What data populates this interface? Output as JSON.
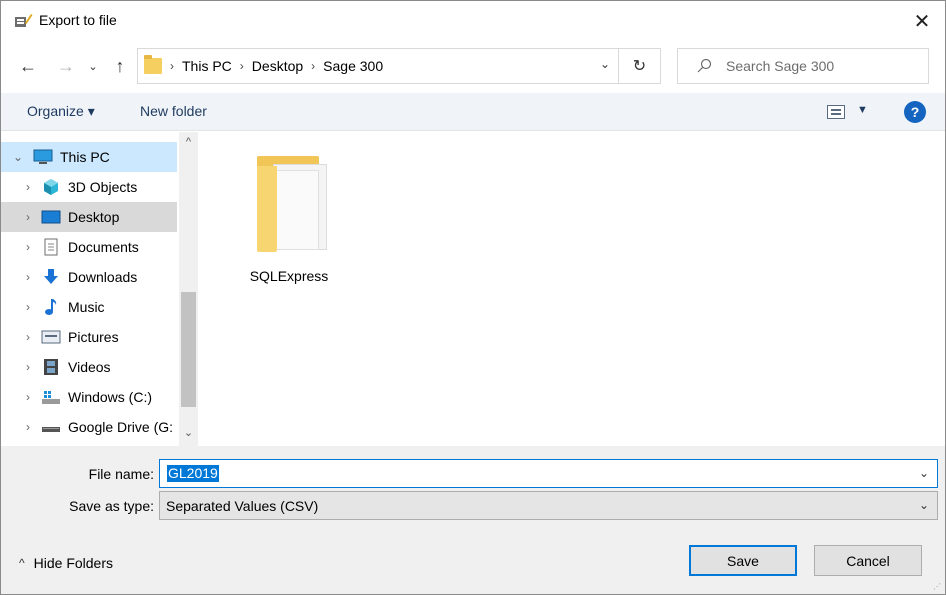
{
  "window": {
    "title": "Export to file",
    "close_label": "✕"
  },
  "address": {
    "crumbs": [
      "This PC",
      "Desktop",
      "Sage 300"
    ],
    "search_placeholder": "Search Sage 300"
  },
  "toolbar": {
    "organize_label": "Organize ▾",
    "new_folder_label": "New folder",
    "help_label": "?"
  },
  "nav": {
    "items": [
      {
        "label": "This PC",
        "icon": "computer-icon",
        "state": "selected",
        "expanded": true
      },
      {
        "label": "3D Objects",
        "icon": "cube-icon",
        "state": ""
      },
      {
        "label": "Desktop",
        "icon": "desktop-icon",
        "state": "desktop"
      },
      {
        "label": "Documents",
        "icon": "document-icon",
        "state": ""
      },
      {
        "label": "Downloads",
        "icon": "download-arrow-icon",
        "state": ""
      },
      {
        "label": "Music",
        "icon": "music-note-icon",
        "state": ""
      },
      {
        "label": "Pictures",
        "icon": "picture-icon",
        "state": ""
      },
      {
        "label": "Videos",
        "icon": "film-icon",
        "state": ""
      },
      {
        "label": "Windows (C:)",
        "icon": "drive-icon",
        "state": ""
      },
      {
        "label": "Google Drive (G:",
        "icon": "drive-icon",
        "state": ""
      }
    ]
  },
  "content": {
    "files": [
      {
        "name": "SQLExpress",
        "type": "folder"
      }
    ]
  },
  "form": {
    "file_name_label": "File name:",
    "file_name_value": "GL2019",
    "save_type_label": "Save as type:",
    "save_type_value": "Separated Values (CSV)"
  },
  "footer": {
    "hide_folders_label": "Hide Folders",
    "save_label": "Save",
    "cancel_label": "Cancel"
  },
  "colors": {
    "accent": "#0078d7",
    "selected_bg": "#cce8ff",
    "toolbar_bg": "#f0f4f9",
    "folder": "#f2c656"
  }
}
